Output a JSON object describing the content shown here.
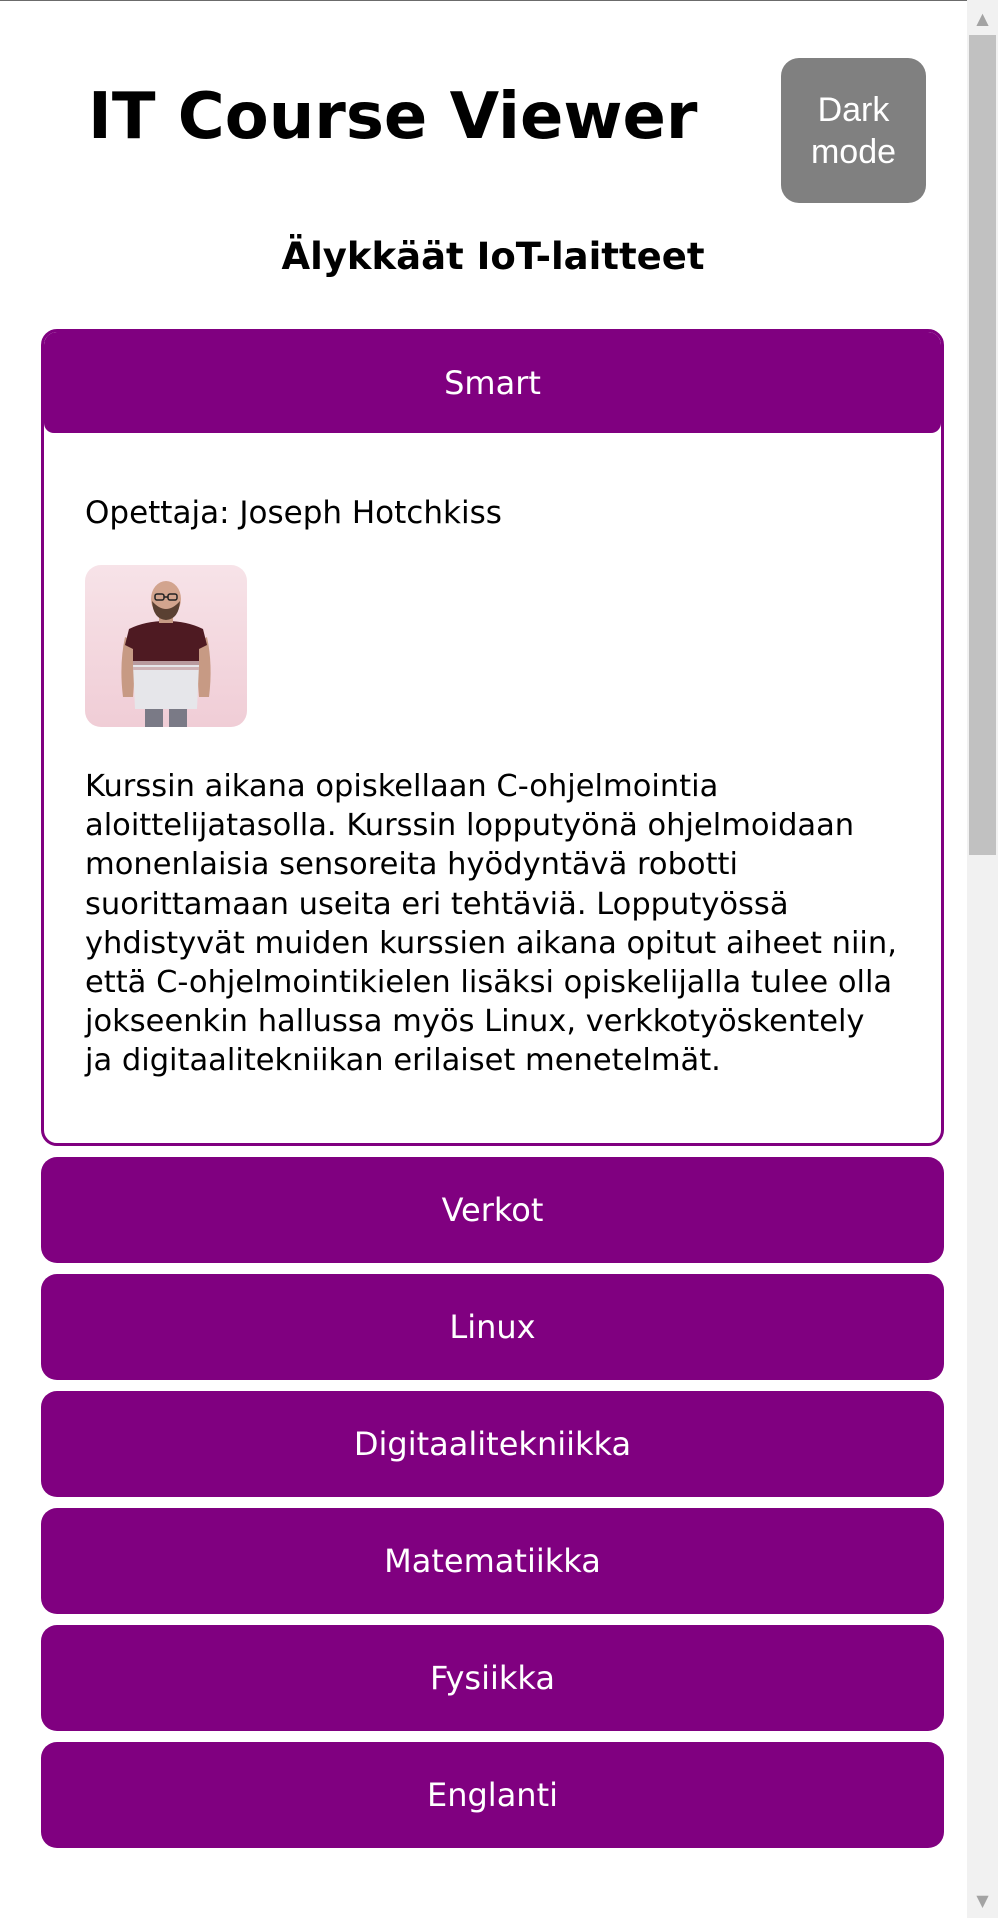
{
  "header": {
    "title": "IT Course Viewer",
    "dark_mode_label": "Dark mode"
  },
  "course": {
    "title": "Älykkäät IoT-laitteet"
  },
  "accordion": {
    "open_section": {
      "label": "Smart",
      "teacher": "Opettaja: Joseph Hotchkiss",
      "description": "Kurssin aikana opiskellaan C-ohjelmointia aloittelijatasolla. Kurssin lopputyönä ohjelmoidaan monenlaisia sensoreita hyödyntävä robotti suorittamaan useita eri tehtäviä. Lopputyössä yhdistyvät muiden kurssien aikana opitut aiheet niin, että C-ohjelmointikielen lisäksi opiskelijalla tulee olla jokseenkin hallussa myös Linux, verkkotyöskentely ja digitaalitekniikan erilaiset menetelmät."
    },
    "sections": [
      "Verkot",
      "Linux",
      "Digitaalitekniikka",
      "Matematiikka",
      "Fysiikka",
      "Englanti"
    ]
  },
  "colors": {
    "accent": "#800080",
    "button_gray": "#808080"
  }
}
